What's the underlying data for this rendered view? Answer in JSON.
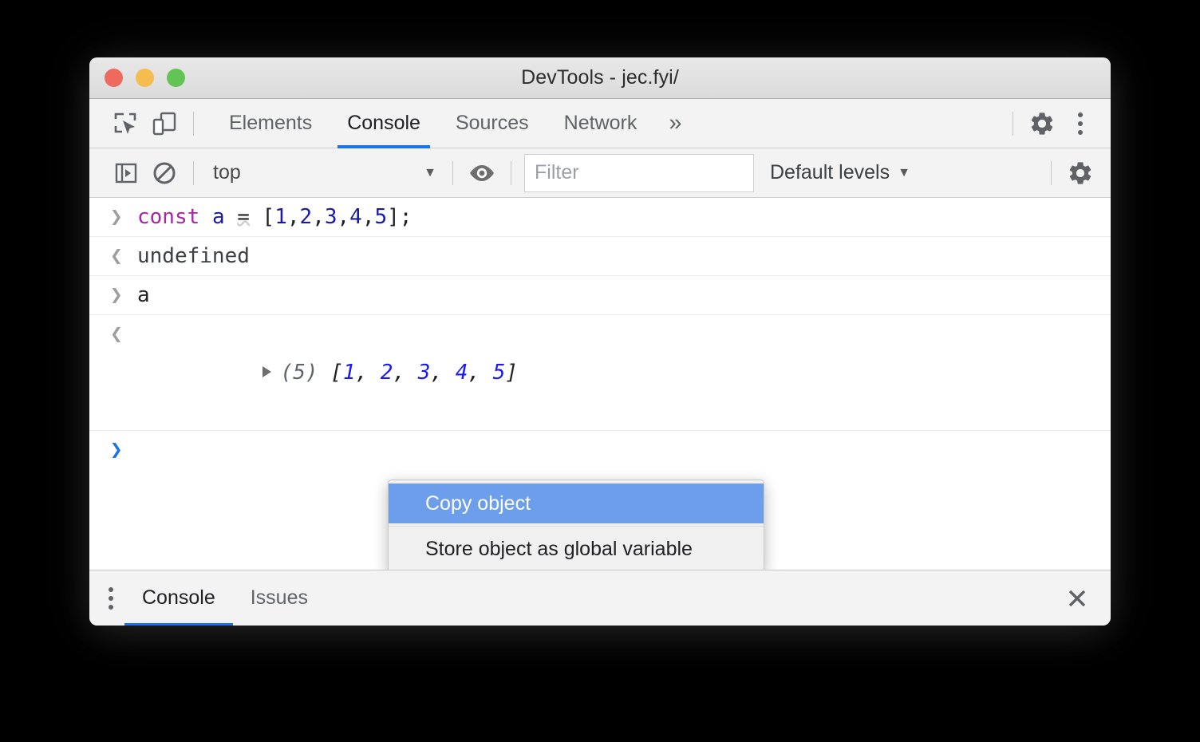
{
  "window": {
    "title": "DevTools - jec.fyi/",
    "traffic_lights": [
      {
        "name": "close",
        "color": "#ee6a5f"
      },
      {
        "name": "minimize",
        "color": "#f5bd4f"
      },
      {
        "name": "zoom",
        "color": "#61c454"
      }
    ]
  },
  "main_toolbar": {
    "inspect_icon": "inspect-element-icon",
    "device_icon": "device-toolbar-icon",
    "tabs": [
      {
        "label": "Elements",
        "active": false
      },
      {
        "label": "Console",
        "active": true
      },
      {
        "label": "Sources",
        "active": false
      },
      {
        "label": "Network",
        "active": false
      }
    ],
    "more_tabs_label": "»",
    "settings_icon": "gear-icon",
    "menu_icon": "kebab-menu-icon"
  },
  "console_toolbar": {
    "sidebar_icon": "console-sidebar-icon",
    "clear_icon": "clear-console-icon",
    "context_value": "top",
    "context_caret": "▼",
    "eye_icon": "live-expression-eye-icon",
    "filter_placeholder": "Filter",
    "filter_value": "",
    "levels_label": "Default levels",
    "levels_caret": "▼",
    "settings_icon": "console-settings-gear-icon"
  },
  "console": {
    "lines": [
      {
        "type": "input",
        "prompt": "❯",
        "tokens": [
          {
            "text": "const",
            "cls": "kw"
          },
          {
            "text": " ",
            "cls": "plain"
          },
          {
            "text": "a",
            "cls": "var"
          },
          {
            "text": " ",
            "cls": "plain"
          },
          {
            "text": "=",
            "cls": "op"
          },
          {
            "text": " [",
            "cls": "plain"
          },
          {
            "text": "1",
            "cls": "num"
          },
          {
            "text": ",",
            "cls": "plain"
          },
          {
            "text": "2",
            "cls": "num"
          },
          {
            "text": ",",
            "cls": "plain"
          },
          {
            "text": "3",
            "cls": "num"
          },
          {
            "text": ",",
            "cls": "plain"
          },
          {
            "text": "4",
            "cls": "num"
          },
          {
            "text": ",",
            "cls": "plain"
          },
          {
            "text": "5",
            "cls": "num"
          },
          {
            "text": "];",
            "cls": "plain"
          }
        ]
      },
      {
        "type": "output",
        "prompt": "❮",
        "text": "undefined"
      },
      {
        "type": "input",
        "prompt": "❯",
        "text": "a"
      },
      {
        "type": "object",
        "prompt": "❮",
        "count_label": "(5)",
        "array_prefix": "[",
        "array_values": [
          "1",
          "2",
          "3",
          "4",
          "5"
        ],
        "array_suffix": "]"
      },
      {
        "type": "prompt",
        "prompt": "❯",
        "text": ""
      }
    ],
    "line1_code": "const a = [1,2,3,4,5];",
    "line2_text": "undefined",
    "line3_text": "a",
    "line4_text": "(5) [1, 2, 3, 4, 5]"
  },
  "context_menu": {
    "items": [
      {
        "label": "Copy object",
        "selected": true
      },
      {
        "label": "Store object as global variable",
        "selected": false
      }
    ],
    "highlight_color": "#6d9eeb"
  },
  "drawer": {
    "menu_icon": "kebab-menu-icon",
    "tabs": [
      {
        "label": "Console",
        "active": true
      },
      {
        "label": "Issues",
        "active": false
      }
    ],
    "close_icon": "close-icon",
    "close_glyph": "✕"
  },
  "colors": {
    "accent": "#1a73e8",
    "menu_highlight": "#6d9eeb",
    "keyword": "#a626a4",
    "number": "#1a1aa6"
  }
}
